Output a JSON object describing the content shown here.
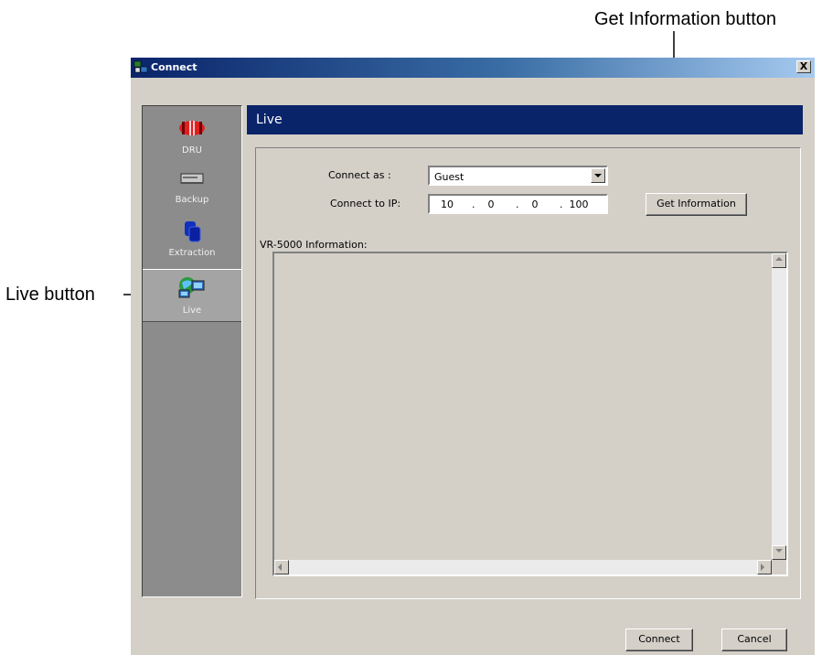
{
  "annotations": {
    "get_information": "Get Information button",
    "live": "Live button"
  },
  "window": {
    "title": "Connect",
    "close_label": "X"
  },
  "sidebar": {
    "items": [
      {
        "label": "DRU",
        "icon": "dru-icon"
      },
      {
        "label": "Backup",
        "icon": "backup-drive-icon"
      },
      {
        "label": "Extraction",
        "icon": "database-icon"
      },
      {
        "label": "Live",
        "icon": "network-globe-icon",
        "selected": true
      }
    ]
  },
  "panel": {
    "header": "Live",
    "connect_as_label": "Connect as :",
    "connect_as_value": "Guest",
    "connect_ip_label": "Connect to IP:",
    "ip": [
      "10",
      "0",
      "0",
      "100"
    ],
    "get_info_label": "Get Information",
    "info_label": "VR-5000 Information:"
  },
  "footer": {
    "connect_label": "Connect",
    "cancel_label": "Cancel"
  },
  "colors": {
    "header_bg": "#0a246a",
    "sidebar_bg": "#8c8c8c",
    "window_bg": "#d4d0c8"
  }
}
